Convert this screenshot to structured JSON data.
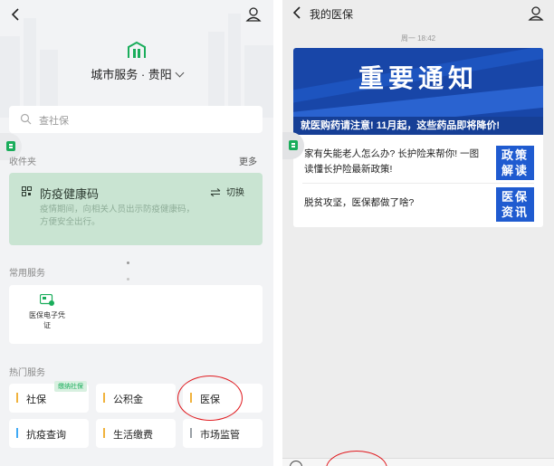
{
  "left_panel": {
    "city_title": "城市服务 · 贵阳",
    "search_placeholder": "查社保",
    "favorites_title": "收件夹",
    "more_label": "更多",
    "health_card": {
      "title": "防疫健康码",
      "switch_label": "切换",
      "description": "疫情期间，向相关人员出示防疫健康码，方便安全出行。"
    },
    "common_services_title": "常用服务",
    "common_services": [
      {
        "label": "医保电子凭证",
        "icon": "medical-card-icon"
      }
    ],
    "hot_services_title": "热门服务",
    "hot_services": [
      {
        "label": "社保",
        "badge": "缴纳社保",
        "color": "#f0b23c"
      },
      {
        "label": "公积金",
        "color": "#f0b23c"
      },
      {
        "label": "医保",
        "color": "#f0b23c"
      },
      {
        "label": "抗疫查询",
        "color": "#3fa9f5"
      },
      {
        "label": "生活缴费",
        "color": "#f0b23c"
      },
      {
        "label": "市场监管",
        "color": "#9aa0a6"
      }
    ]
  },
  "right_panel": {
    "title": "我的医保",
    "timestamp": "周一 18:42",
    "banner": {
      "headline": "重要通知",
      "subtitle": "就医购药请注意! 11月起，这些药品即将降价!"
    },
    "articles": [
      {
        "text": "家有失能老人怎么办? 长护险来帮你! 一图读懂长护险最新政策!",
        "thumb": "政策解读"
      },
      {
        "text": "脱贫攻坚，医保都做了啥?",
        "thumb": "医保资讯"
      }
    ]
  },
  "colors": {
    "wechat_green": "#1aad5b",
    "health_card_bg": "#c9e4d2",
    "banner_blue": "#1846a8",
    "annotation_red": "#e0191e"
  }
}
